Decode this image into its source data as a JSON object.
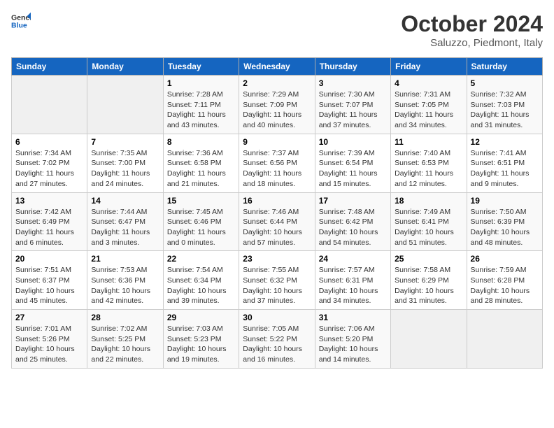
{
  "logo": {
    "line1": "General",
    "line2": "Blue"
  },
  "title": "October 2024",
  "subtitle": "Saluzzo, Piedmont, Italy",
  "weekdays": [
    "Sunday",
    "Monday",
    "Tuesday",
    "Wednesday",
    "Thursday",
    "Friday",
    "Saturday"
  ],
  "weeks": [
    [
      {
        "day": "",
        "sunrise": "",
        "sunset": "",
        "daylight": ""
      },
      {
        "day": "",
        "sunrise": "",
        "sunset": "",
        "daylight": ""
      },
      {
        "day": "1",
        "sunrise": "Sunrise: 7:28 AM",
        "sunset": "Sunset: 7:11 PM",
        "daylight": "Daylight: 11 hours and 43 minutes."
      },
      {
        "day": "2",
        "sunrise": "Sunrise: 7:29 AM",
        "sunset": "Sunset: 7:09 PM",
        "daylight": "Daylight: 11 hours and 40 minutes."
      },
      {
        "day": "3",
        "sunrise": "Sunrise: 7:30 AM",
        "sunset": "Sunset: 7:07 PM",
        "daylight": "Daylight: 11 hours and 37 minutes."
      },
      {
        "day": "4",
        "sunrise": "Sunrise: 7:31 AM",
        "sunset": "Sunset: 7:05 PM",
        "daylight": "Daylight: 11 hours and 34 minutes."
      },
      {
        "day": "5",
        "sunrise": "Sunrise: 7:32 AM",
        "sunset": "Sunset: 7:03 PM",
        "daylight": "Daylight: 11 hours and 31 minutes."
      }
    ],
    [
      {
        "day": "6",
        "sunrise": "Sunrise: 7:34 AM",
        "sunset": "Sunset: 7:02 PM",
        "daylight": "Daylight: 11 hours and 27 minutes."
      },
      {
        "day": "7",
        "sunrise": "Sunrise: 7:35 AM",
        "sunset": "Sunset: 7:00 PM",
        "daylight": "Daylight: 11 hours and 24 minutes."
      },
      {
        "day": "8",
        "sunrise": "Sunrise: 7:36 AM",
        "sunset": "Sunset: 6:58 PM",
        "daylight": "Daylight: 11 hours and 21 minutes."
      },
      {
        "day": "9",
        "sunrise": "Sunrise: 7:37 AM",
        "sunset": "Sunset: 6:56 PM",
        "daylight": "Daylight: 11 hours and 18 minutes."
      },
      {
        "day": "10",
        "sunrise": "Sunrise: 7:39 AM",
        "sunset": "Sunset: 6:54 PM",
        "daylight": "Daylight: 11 hours and 15 minutes."
      },
      {
        "day": "11",
        "sunrise": "Sunrise: 7:40 AM",
        "sunset": "Sunset: 6:53 PM",
        "daylight": "Daylight: 11 hours and 12 minutes."
      },
      {
        "day": "12",
        "sunrise": "Sunrise: 7:41 AM",
        "sunset": "Sunset: 6:51 PM",
        "daylight": "Daylight: 11 hours and 9 minutes."
      }
    ],
    [
      {
        "day": "13",
        "sunrise": "Sunrise: 7:42 AM",
        "sunset": "Sunset: 6:49 PM",
        "daylight": "Daylight: 11 hours and 6 minutes."
      },
      {
        "day": "14",
        "sunrise": "Sunrise: 7:44 AM",
        "sunset": "Sunset: 6:47 PM",
        "daylight": "Daylight: 11 hours and 3 minutes."
      },
      {
        "day": "15",
        "sunrise": "Sunrise: 7:45 AM",
        "sunset": "Sunset: 6:46 PM",
        "daylight": "Daylight: 11 hours and 0 minutes."
      },
      {
        "day": "16",
        "sunrise": "Sunrise: 7:46 AM",
        "sunset": "Sunset: 6:44 PM",
        "daylight": "Daylight: 10 hours and 57 minutes."
      },
      {
        "day": "17",
        "sunrise": "Sunrise: 7:48 AM",
        "sunset": "Sunset: 6:42 PM",
        "daylight": "Daylight: 10 hours and 54 minutes."
      },
      {
        "day": "18",
        "sunrise": "Sunrise: 7:49 AM",
        "sunset": "Sunset: 6:41 PM",
        "daylight": "Daylight: 10 hours and 51 minutes."
      },
      {
        "day": "19",
        "sunrise": "Sunrise: 7:50 AM",
        "sunset": "Sunset: 6:39 PM",
        "daylight": "Daylight: 10 hours and 48 minutes."
      }
    ],
    [
      {
        "day": "20",
        "sunrise": "Sunrise: 7:51 AM",
        "sunset": "Sunset: 6:37 PM",
        "daylight": "Daylight: 10 hours and 45 minutes."
      },
      {
        "day": "21",
        "sunrise": "Sunrise: 7:53 AM",
        "sunset": "Sunset: 6:36 PM",
        "daylight": "Daylight: 10 hours and 42 minutes."
      },
      {
        "day": "22",
        "sunrise": "Sunrise: 7:54 AM",
        "sunset": "Sunset: 6:34 PM",
        "daylight": "Daylight: 10 hours and 39 minutes."
      },
      {
        "day": "23",
        "sunrise": "Sunrise: 7:55 AM",
        "sunset": "Sunset: 6:32 PM",
        "daylight": "Daylight: 10 hours and 37 minutes."
      },
      {
        "day": "24",
        "sunrise": "Sunrise: 7:57 AM",
        "sunset": "Sunset: 6:31 PM",
        "daylight": "Daylight: 10 hours and 34 minutes."
      },
      {
        "day": "25",
        "sunrise": "Sunrise: 7:58 AM",
        "sunset": "Sunset: 6:29 PM",
        "daylight": "Daylight: 10 hours and 31 minutes."
      },
      {
        "day": "26",
        "sunrise": "Sunrise: 7:59 AM",
        "sunset": "Sunset: 6:28 PM",
        "daylight": "Daylight: 10 hours and 28 minutes."
      }
    ],
    [
      {
        "day": "27",
        "sunrise": "Sunrise: 7:01 AM",
        "sunset": "Sunset: 5:26 PM",
        "daylight": "Daylight: 10 hours and 25 minutes."
      },
      {
        "day": "28",
        "sunrise": "Sunrise: 7:02 AM",
        "sunset": "Sunset: 5:25 PM",
        "daylight": "Daylight: 10 hours and 22 minutes."
      },
      {
        "day": "29",
        "sunrise": "Sunrise: 7:03 AM",
        "sunset": "Sunset: 5:23 PM",
        "daylight": "Daylight: 10 hours and 19 minutes."
      },
      {
        "day": "30",
        "sunrise": "Sunrise: 7:05 AM",
        "sunset": "Sunset: 5:22 PM",
        "daylight": "Daylight: 10 hours and 16 minutes."
      },
      {
        "day": "31",
        "sunrise": "Sunrise: 7:06 AM",
        "sunset": "Sunset: 5:20 PM",
        "daylight": "Daylight: 10 hours and 14 minutes."
      },
      {
        "day": "",
        "sunrise": "",
        "sunset": "",
        "daylight": ""
      },
      {
        "day": "",
        "sunrise": "",
        "sunset": "",
        "daylight": ""
      }
    ]
  ]
}
